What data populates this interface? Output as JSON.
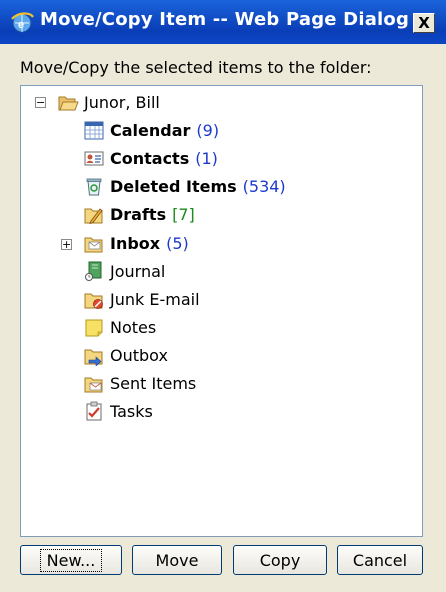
{
  "window": {
    "title": "Move/Copy Item -- Web Page Dialog",
    "close_label": "X"
  },
  "prompt": "Move/Copy the selected items to the folder:",
  "tree": {
    "root": {
      "label": "Junor, Bill",
      "icon": "folder-open-icon",
      "expander": "−"
    },
    "items": [
      {
        "label": "Calendar",
        "count": "(9)",
        "bold": true,
        "icon": "calendar-icon"
      },
      {
        "label": "Contacts",
        "count": "(1)",
        "bold": true,
        "icon": "contacts-icon"
      },
      {
        "label": "Deleted Items",
        "count": "(534)",
        "bold": true,
        "icon": "deleted-items-icon"
      },
      {
        "label": "Drafts",
        "count": "[7]",
        "bold": true,
        "icon": "drafts-icon",
        "count_color": "#1e8a1e"
      },
      {
        "label": "Inbox",
        "count": "(5)",
        "bold": true,
        "icon": "inbox-icon",
        "expander": "+"
      },
      {
        "label": "Journal",
        "count": "",
        "bold": false,
        "icon": "journal-icon"
      },
      {
        "label": "Junk E-mail",
        "count": "",
        "bold": false,
        "icon": "junk-email-icon"
      },
      {
        "label": "Notes",
        "count": "",
        "bold": false,
        "icon": "notes-icon"
      },
      {
        "label": "Outbox",
        "count": "",
        "bold": false,
        "icon": "outbox-icon"
      },
      {
        "label": "Sent Items",
        "count": "",
        "bold": false,
        "icon": "sent-items-icon"
      },
      {
        "label": "Tasks",
        "count": "",
        "bold": false,
        "icon": "tasks-icon"
      }
    ]
  },
  "buttons": {
    "new": "New...",
    "move": "Move",
    "copy": "Copy",
    "cancel": "Cancel"
  },
  "colors": {
    "titlebar": "#0a3eb7",
    "count_blue": "#1b3acb",
    "count_green": "#1e8a1e",
    "dialog_bg": "#ece9d8"
  }
}
